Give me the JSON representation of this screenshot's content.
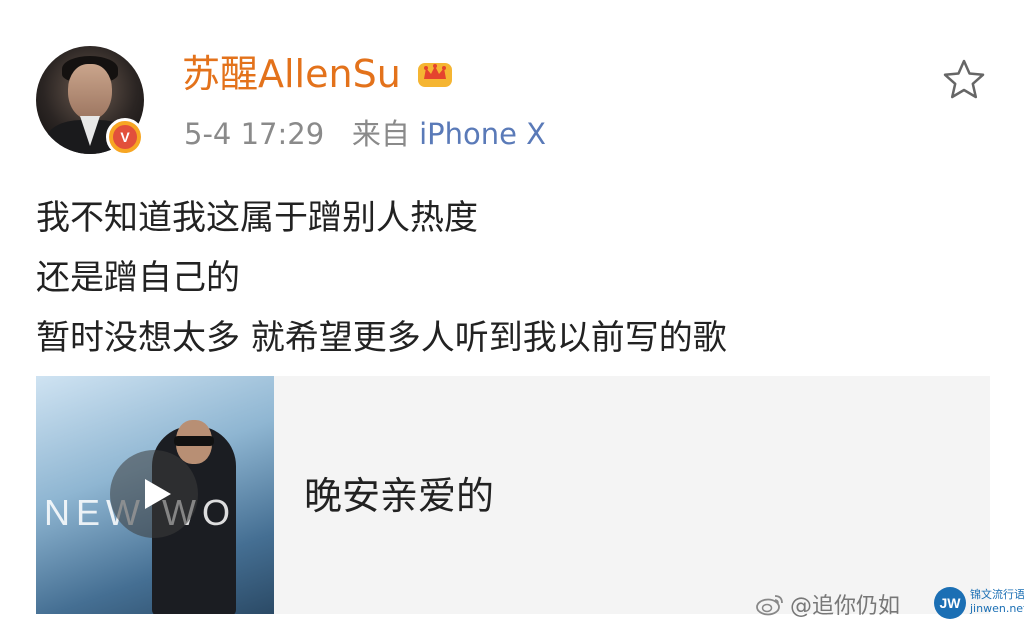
{
  "post": {
    "username": "苏醒AllenSu",
    "verified_badge": "V",
    "time": "5-4 17:29",
    "source_prefix": "来自",
    "source_device": "iPhone X",
    "lines": [
      "我不知道我这属于蹭别人热度",
      "还是蹭自己的",
      "暂时没想太多 就希望更多人听到我以前写的歌"
    ]
  },
  "music_card": {
    "cover_logo": "NEW WO",
    "title": "晚安亲爱的"
  },
  "watermark": {
    "handle": "@追你仍如",
    "site_name": "锦文流行语",
    "site_url": "jinwen.net",
    "site_badge": "JW"
  },
  "colors": {
    "username": "#e3721b",
    "source": "#5a7ab8",
    "meta": "#8a8a8a"
  },
  "icons": {
    "favorite": "star-outline-icon",
    "member": "crown-icon",
    "play": "play-icon"
  }
}
